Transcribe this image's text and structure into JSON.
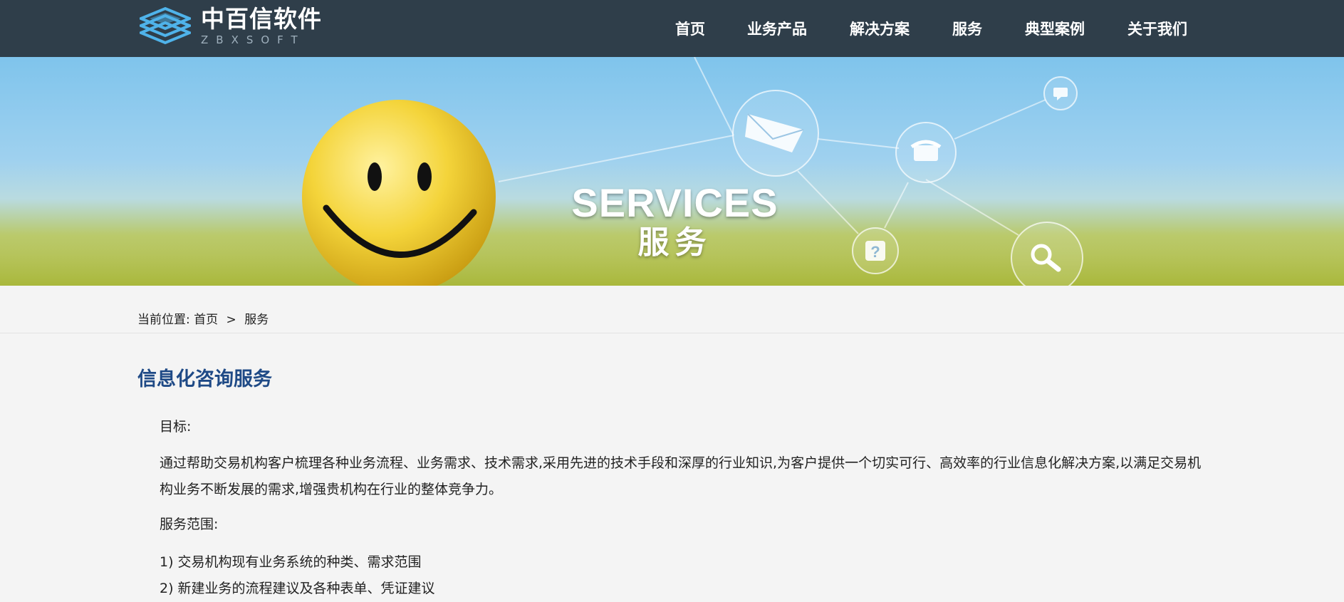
{
  "header": {
    "logo_cn": "中百信软件",
    "logo_en": "ZBXSOFT",
    "nav": [
      "首页",
      "业务产品",
      "解决方案",
      "服务",
      "典型案例",
      "关于我们"
    ]
  },
  "banner": {
    "title": "SERVICES",
    "subtitle": "服务"
  },
  "breadcrumb": {
    "prefix": "当前位置:",
    "home": "首页",
    "separator": ">",
    "current": "服务"
  },
  "main": {
    "title": "信息化咨询服务",
    "goal_label": "目标:",
    "goal_text": "通过帮助交易机构客户梳理各种业务流程、业务需求、技术需求,采用先进的技术手段和深厚的行业知识,为客户提供一个切实可行、高效率的行业信息化解决方案,以满足交易机构业务不断发展的需求,增强贵机构在行业的整体竞争力。",
    "scope_label": "服务范围:",
    "scope_items": [
      "1) 交易机构现有业务系统的种类、需求范围",
      "2) 新建业务的流程建议及各种表单、凭证建议"
    ]
  },
  "colors": {
    "header_bg": "#2f3e4a",
    "title_blue": "#1f4a86",
    "page_bg": "#f4f4f4"
  }
}
